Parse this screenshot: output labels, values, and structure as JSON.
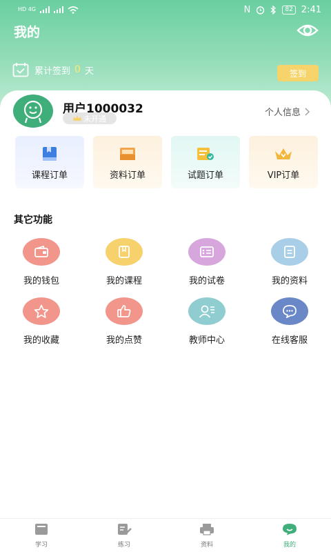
{
  "status_bar": {
    "signal_left": "HD 4G",
    "nfc": "N",
    "battery": "82",
    "time": "2:41"
  },
  "header": {
    "title": "我的",
    "checkin_prefix": "累计签到",
    "checkin_days": "0",
    "checkin_suffix": "天",
    "checkin_button": "签到"
  },
  "user": {
    "name": "用户1000032",
    "vip_status": "未开通",
    "profile_link": "个人信息"
  },
  "orders": [
    {
      "label": "课程订单"
    },
    {
      "label": "资料订单"
    },
    {
      "label": "试题订单"
    },
    {
      "label": "VIP订单"
    }
  ],
  "section": {
    "title": "其它功能"
  },
  "functions": [
    {
      "label": "我的钱包",
      "icon": "wallet-icon",
      "color": "#f2958a"
    },
    {
      "label": "我的课程",
      "icon": "course-icon",
      "color": "#f7d16b"
    },
    {
      "label": "我的试卷",
      "icon": "exam-paper-icon",
      "color": "#d7a6dc"
    },
    {
      "label": "我的资料",
      "icon": "document-icon",
      "color": "#a9cfe8"
    },
    {
      "label": "我的收藏",
      "icon": "star-icon",
      "color": "#f2958a"
    },
    {
      "label": "我的点赞",
      "icon": "thumbs-up-icon",
      "color": "#f2958a"
    },
    {
      "label": "教师中心",
      "icon": "teacher-icon",
      "color": "#8fcdd0"
    },
    {
      "label": "在线客服",
      "icon": "chat-icon",
      "color": "#6a87c8"
    }
  ],
  "tabs": [
    {
      "label": "学习",
      "active": false
    },
    {
      "label": "练习",
      "active": false
    },
    {
      "label": "资料",
      "active": false
    },
    {
      "label": "我的",
      "active": true
    }
  ],
  "colors": {
    "brand": "#3fae7a",
    "header": "#69cfa0",
    "checkin_button": "#f6d46b"
  }
}
